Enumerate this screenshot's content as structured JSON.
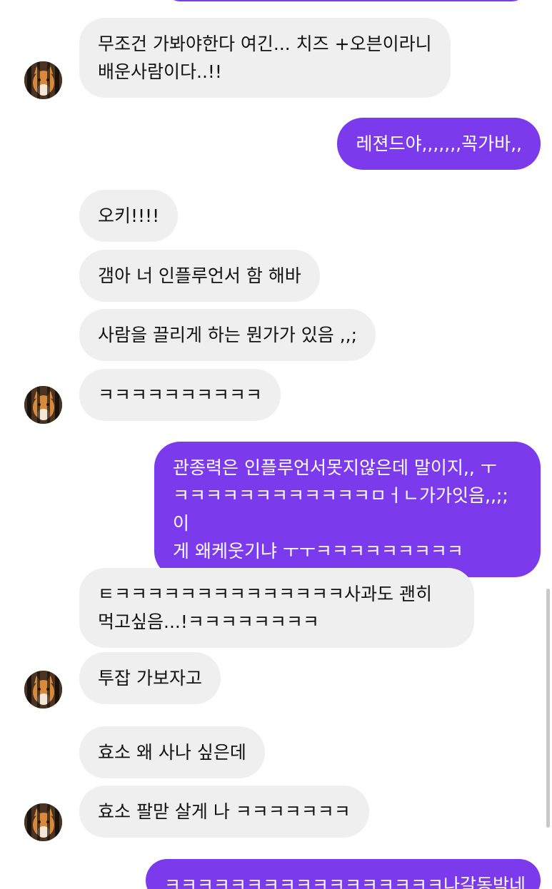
{
  "colors": {
    "outgoing": "#7c3aed",
    "incoming": "#efefef",
    "incoming_text": "#111111",
    "outgoing_text": "#ffffff"
  },
  "avatar_icon": "cat-avatar-icon",
  "messages": [
    {
      "direction": "in",
      "text": "무조건 가봐야한다 여긴... 치즈 +오븐이라니\n배운사람이다..!!"
    },
    {
      "direction": "out",
      "text": "레젼드야,,,,,,,꼭가바,,"
    },
    {
      "direction": "in",
      "text": "오키!!!!"
    },
    {
      "direction": "in",
      "text": "갬아 너 인플루언서 함 해바"
    },
    {
      "direction": "in",
      "text": "사람을 끌리게 하는 뭔가가 있음 ,,;"
    },
    {
      "direction": "in",
      "text": "ㅋㅋㅋㅋㅋㅋㅋㅋㅋㅋ"
    },
    {
      "direction": "out",
      "text": "관종력은 인플루언서못지않은데 말이지,, ㅜ\nㅋㅋㅋㅋㅋㅋㅋㅋㅋㅋㅋㅋㅁㅓㄴ가가잇음,,;; 이\n게 왜케웃기냐 ㅜㅜㅋㅋㅋㅋㅋㅋㅋㅋㅋ"
    },
    {
      "direction": "in",
      "text": "ㅌㅋㅋㅋㅋㅋㅋㅋㅋㅋㅋㅋㅋㅋㅋ사과도 괜히\n먹고싶음...!ㅋㅋㅋㅋㅋㅋㅋㅋ"
    },
    {
      "direction": "in",
      "text": "투잡 가보자고"
    },
    {
      "direction": "in",
      "text": "효소 왜 사나 싶은데"
    },
    {
      "direction": "in",
      "text": "효소 팔맏 살게 나 ㅋㅋㅋㅋㅋㅋㅋ"
    },
    {
      "direction": "out",
      "text": "ㅋㅋㅋㅋㅋㅋㅋㅋㅋㅋㅋㅋㅋㅋㅋㅋㅋ나갈동박네 새"
    }
  ]
}
